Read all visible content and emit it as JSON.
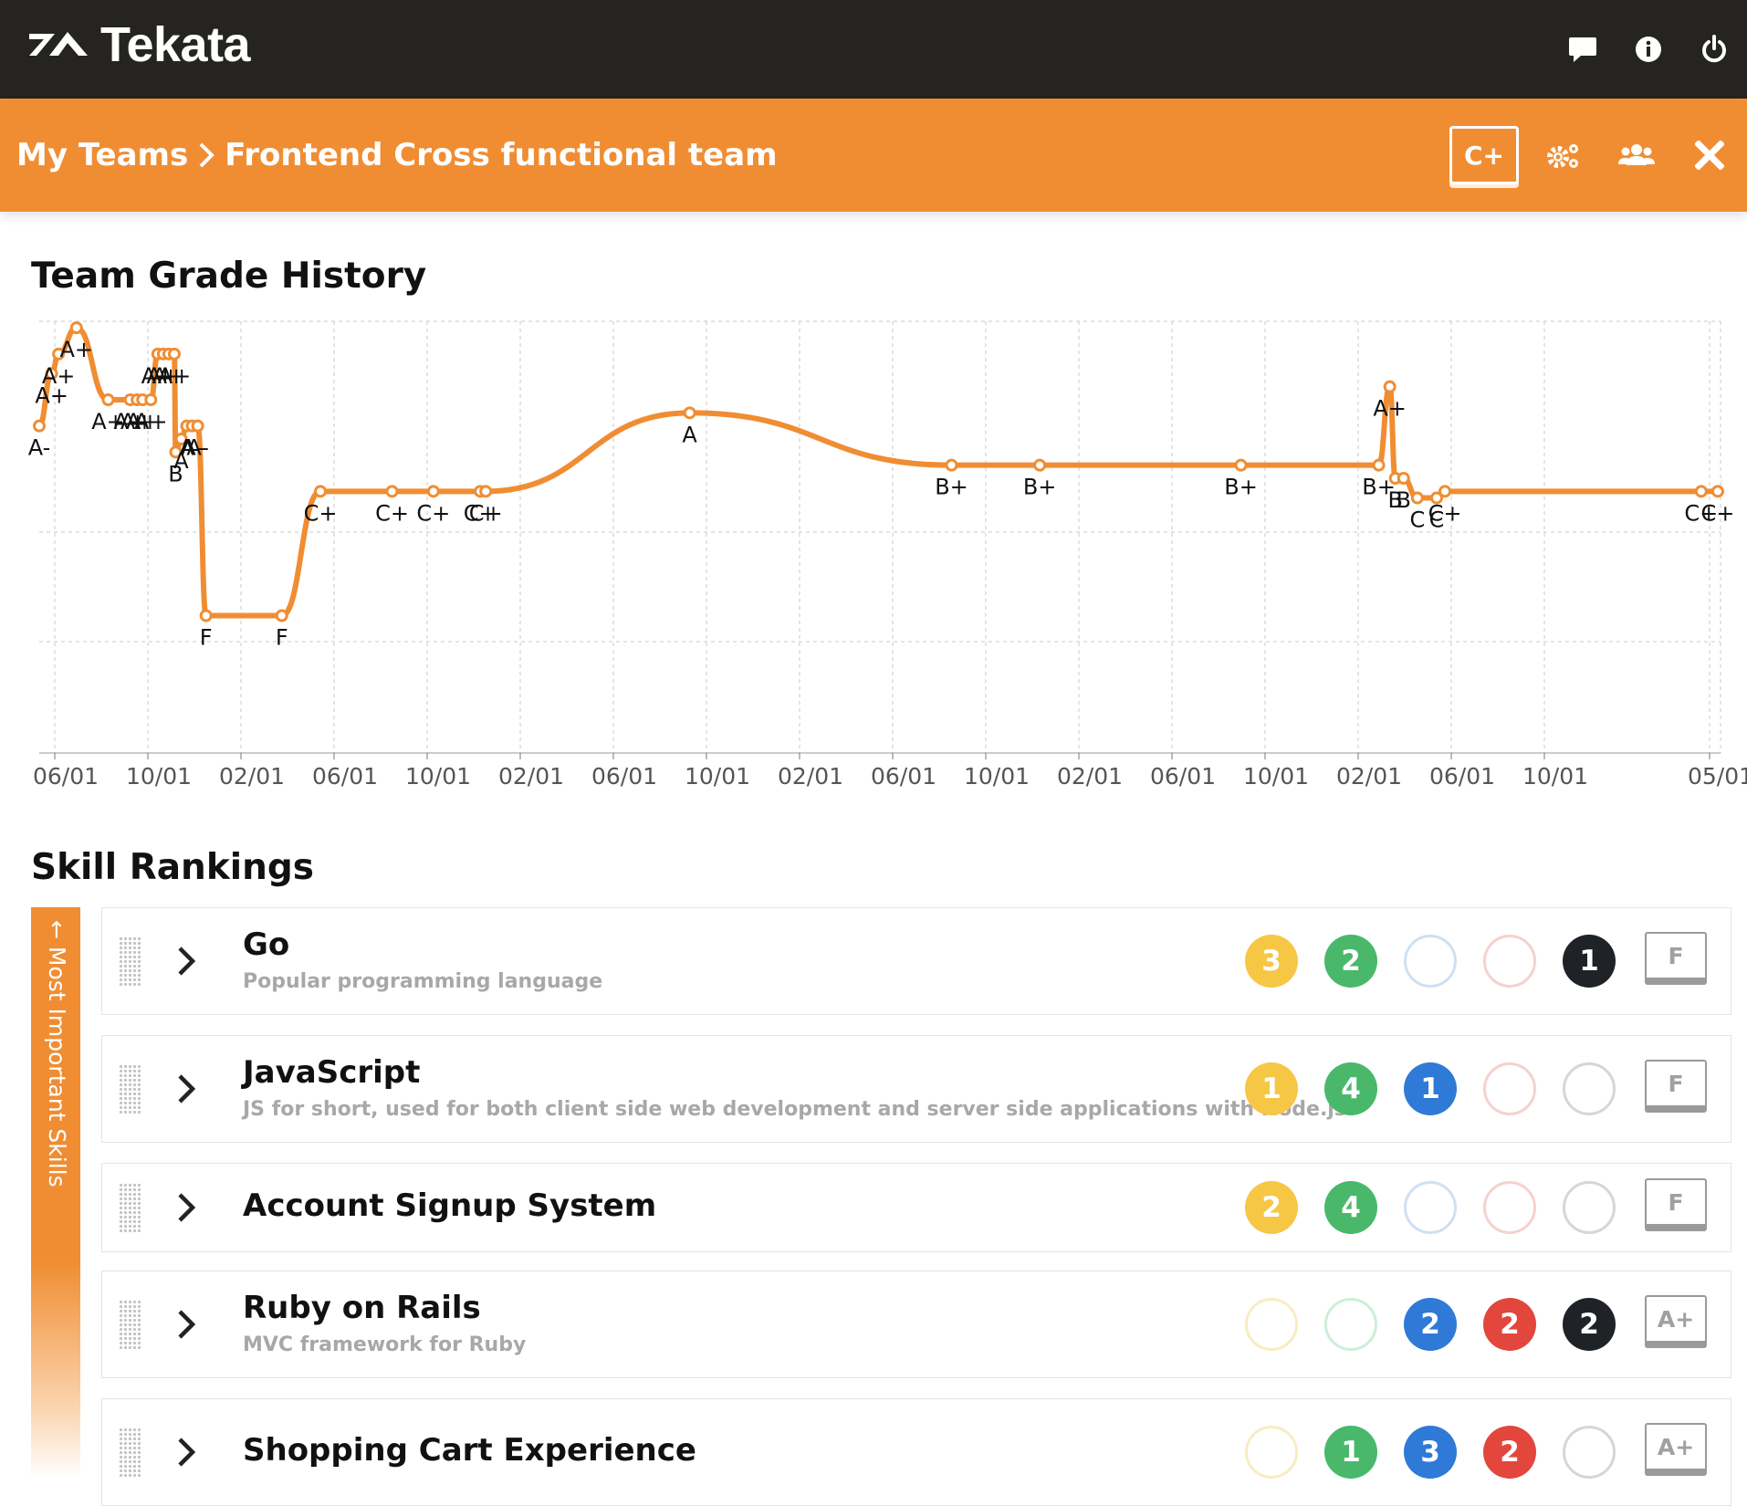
{
  "app": {
    "name": "Tekata",
    "top_icons": [
      "chat-icon",
      "info-icon",
      "power-icon"
    ]
  },
  "breadcrumb": {
    "parent": "My Teams",
    "current": "Frontend Cross functional team",
    "team_grade": "C+",
    "action_icons": [
      "settings-icon",
      "members-icon",
      "close-icon"
    ]
  },
  "sections": {
    "history_title": "Team Grade History",
    "rankings_title": "Skill Rankings",
    "rail_label": "← Most Important Skills"
  },
  "colors": {
    "topbar": "#262421",
    "accent": "#f08d33",
    "yellow": "#f6c744",
    "green": "#49b86b",
    "blue": "#2f7ad6",
    "red": "#e2463d",
    "black": "#1f2226"
  },
  "chart_data": {
    "type": "line",
    "title": "Team Grade History",
    "xlabel": "",
    "ylabel": "",
    "x_tick_labels": [
      "06/01",
      "10/01",
      "02/01",
      "06/01",
      "10/01",
      "02/01",
      "06/01",
      "10/01",
      "02/01",
      "06/01",
      "10/01",
      "02/01",
      "06/01",
      "10/01",
      "02/01",
      "06/01",
      "10/01",
      "05/01"
    ],
    "grid": true,
    "y_scale_note": "grade scale F (low) to A+ (high)",
    "series": [
      {
        "points": [
          {
            "t": 0.0,
            "y": 95.0,
            "grade": "A-"
          },
          {
            "t": 0.45,
            "y": 99.0,
            "grade": "A+"
          },
          {
            "t": 0.7,
            "y": 100.5,
            "grade": "A+"
          },
          {
            "t": 1.35,
            "y": 102.5,
            "grade": "A+"
          },
          {
            "t": 2.5,
            "y": 97.0,
            "grade": "A+"
          },
          {
            "t": 3.3,
            "y": 97.0,
            "grade": "A+"
          },
          {
            "t": 3.55,
            "y": 97.0,
            "grade": "A+"
          },
          {
            "t": 3.75,
            "y": 97.0,
            "grade": "A+"
          },
          {
            "t": 4.05,
            "y": 97.0,
            "grade": "A+"
          },
          {
            "t": 4.3,
            "y": 100.5,
            "grade": "A+"
          },
          {
            "t": 4.5,
            "y": 100.5,
            "grade": "A+"
          },
          {
            "t": 4.7,
            "y": 100.5,
            "grade": "A+"
          },
          {
            "t": 4.9,
            "y": 100.5,
            "grade": "A+"
          },
          {
            "t": 4.95,
            "y": 93.0,
            "grade": "B"
          },
          {
            "t": 5.15,
            "y": 94.0,
            "grade": "A"
          },
          {
            "t": 5.35,
            "y": 95.0,
            "grade": "A"
          },
          {
            "t": 5.55,
            "y": 95.0,
            "grade": "A-"
          },
          {
            "t": 5.75,
            "y": 95.0,
            "grade": "A-"
          },
          {
            "t": 6.05,
            "y": 80.5,
            "grade": "F"
          },
          {
            "t": 8.8,
            "y": 80.5,
            "grade": "F"
          },
          {
            "t": 10.2,
            "y": 90.0,
            "grade": "C+"
          },
          {
            "t": 12.8,
            "y": 90.0,
            "grade": "C+"
          },
          {
            "t": 14.3,
            "y": 90.0,
            "grade": "C+"
          },
          {
            "t": 16.0,
            "y": 90.0,
            "grade": "C+"
          },
          {
            "t": 16.2,
            "y": 90.0,
            "grade": "C+"
          },
          {
            "t": 23.6,
            "y": 96.0,
            "grade": "A"
          },
          {
            "t": 33.1,
            "y": 92.0,
            "grade": "B+"
          },
          {
            "t": 36.3,
            "y": 92.0,
            "grade": "B+"
          },
          {
            "t": 43.6,
            "y": 92.0,
            "grade": "B+"
          },
          {
            "t": 48.6,
            "y": 92.0,
            "grade": "B+"
          },
          {
            "t": 49.0,
            "y": 98.0,
            "grade": "A+"
          },
          {
            "t": 49.2,
            "y": 91.0,
            "grade": "B"
          },
          {
            "t": 49.5,
            "y": 91.0,
            "grade": "B"
          },
          {
            "t": 50.0,
            "y": 89.5,
            "grade": "C"
          },
          {
            "t": 50.7,
            "y": 89.5,
            "grade": "C"
          },
          {
            "t": 51.0,
            "y": 90.0,
            "grade": "C+"
          },
          {
            "t": 60.3,
            "y": 90.0,
            "grade": "C+"
          },
          {
            "t": 60.9,
            "y": 90.0,
            "grade": "C+"
          }
        ]
      }
    ]
  },
  "skills": [
    {
      "name": "Go",
      "description": "Popular programming language",
      "counts": [
        "3",
        "2",
        "",
        "",
        "1"
      ],
      "grade": "F"
    },
    {
      "name": "JavaScript",
      "description": "JS for short, used for both client side web development and server side applications with Node.js",
      "counts": [
        "1",
        "4",
        "1",
        "",
        ""
      ],
      "grade": "F"
    },
    {
      "name": "Account Signup System",
      "description": "",
      "counts": [
        "2",
        "4",
        "",
        "",
        ""
      ],
      "grade": "F"
    },
    {
      "name": "Ruby on Rails",
      "description": "MVC framework for Ruby",
      "counts": [
        "",
        "",
        "2",
        "2",
        "2"
      ],
      "grade": "A+"
    },
    {
      "name": "Shopping Cart Experience",
      "description": "",
      "counts": [
        "",
        "1",
        "3",
        "2",
        ""
      ],
      "grade": "A+"
    }
  ]
}
